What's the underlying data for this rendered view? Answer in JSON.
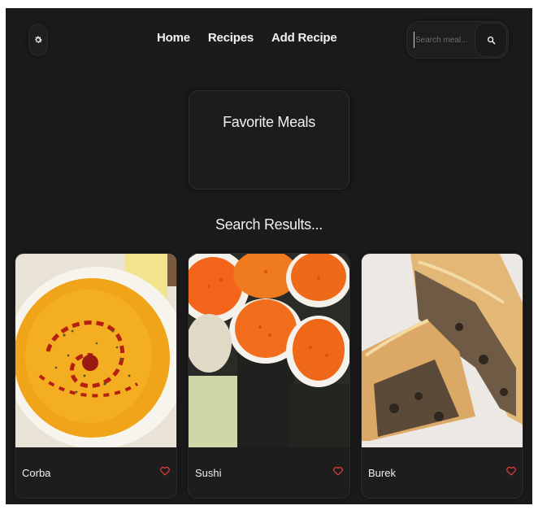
{
  "header": {
    "theme_icon": "gear-icon",
    "nav": [
      {
        "label": "Home"
      },
      {
        "label": "Recipes"
      },
      {
        "label": "Add Recipe"
      }
    ],
    "search": {
      "placeholder": "Search meal...",
      "value": "",
      "icon": "search-icon"
    }
  },
  "favorites": {
    "title": "Favorite Meals"
  },
  "results": {
    "title": "Search Results...",
    "meals": [
      {
        "name": "Corba",
        "icon": "heart-outline-icon"
      },
      {
        "name": "Sushi",
        "icon": "heart-outline-icon"
      },
      {
        "name": "Burek",
        "icon": "heart-outline-icon"
      }
    ]
  },
  "colors": {
    "background": "#1b1b1b",
    "heart": "#e03a3a",
    "text": "#f0f0f0"
  }
}
